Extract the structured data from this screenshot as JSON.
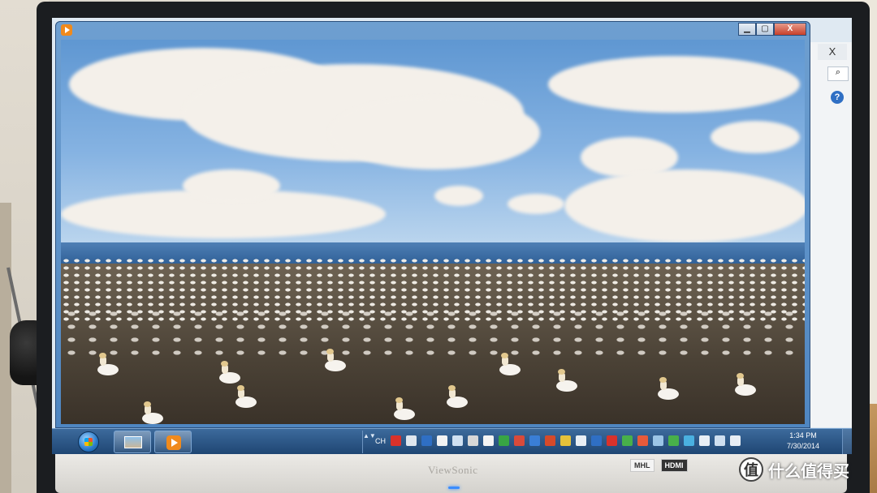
{
  "monitor": {
    "brand": "ViewSonic",
    "badges": [
      "MHL",
      "HDMI"
    ],
    "watermark": "什么值得买",
    "watermark_logo": "值"
  },
  "background_window": {
    "close_glyph": "X",
    "search_glyph": "⌕",
    "help_glyph": "?"
  },
  "player_window": {
    "minimize_glyph": "▁",
    "maximize_glyph": "▢",
    "close_glyph": "X",
    "video_description": "gannet colony by the sea"
  },
  "taskbar": {
    "tray_expand": "▲▼",
    "language": "CH",
    "time": "1:34 PM",
    "date": "7/30/2014",
    "tray_icons": [
      {
        "name": "pdf-icon",
        "color": "#d9322b"
      },
      {
        "name": "keyboard-icon",
        "color": "#dfe6ee"
      },
      {
        "name": "help-icon",
        "color": "#2f6fc4"
      },
      {
        "name": "qq-icon",
        "color": "#f2f2f2"
      },
      {
        "name": "cloud-icon",
        "color": "#cfe0f2"
      },
      {
        "name": "shield-icon",
        "color": "#d7d7d7"
      },
      {
        "name": "app-icon",
        "color": "#f4f4f4"
      },
      {
        "name": "green-app-icon",
        "color": "#38a544"
      },
      {
        "name": "red-app-icon",
        "color": "#d94a3a"
      },
      {
        "name": "bluetooth-icon",
        "color": "#3a7ed6"
      },
      {
        "name": "gift-icon",
        "color": "#d64a2a"
      },
      {
        "name": "chart-icon",
        "color": "#e6c23a"
      },
      {
        "name": "monitor-icon",
        "color": "#e8eef5"
      },
      {
        "name": "vpn-icon",
        "color": "#2f6fc4"
      },
      {
        "name": "kingsoft-icon",
        "color": "#d9322b"
      },
      {
        "name": "refresh-icon",
        "color": "#48b04a"
      },
      {
        "name": "flag-icon",
        "color": "#e85a3a"
      },
      {
        "name": "table-icon",
        "color": "#9bc4e6"
      },
      {
        "name": "network-icon",
        "color": "#48b04a"
      },
      {
        "name": "sync-icon",
        "color": "#4ab0e0"
      },
      {
        "name": "battery-icon",
        "color": "#e8eef5"
      },
      {
        "name": "display-icon",
        "color": "#cfdff0"
      },
      {
        "name": "volume-icon",
        "color": "#e8eef5"
      }
    ]
  }
}
